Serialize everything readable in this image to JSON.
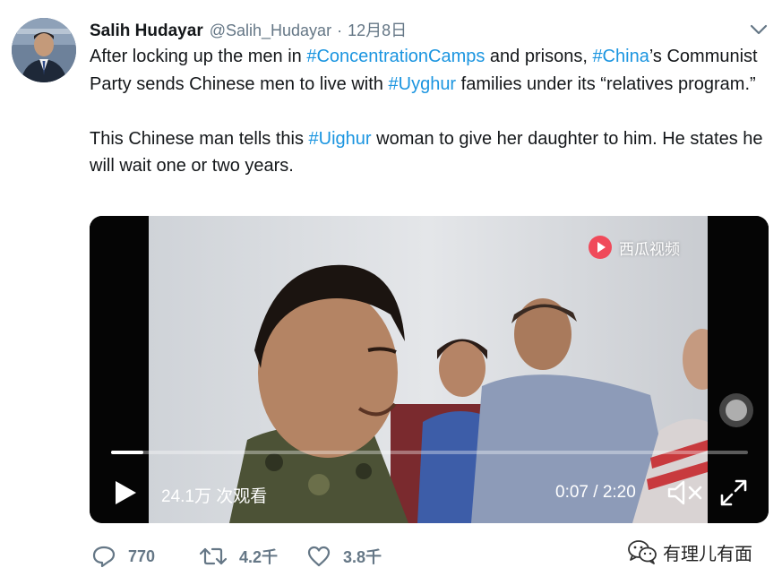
{
  "author": {
    "name": "Salih Hudayar",
    "handle": "@Salih_Hudayar",
    "separator": "·",
    "date": "12月8日"
  },
  "tweet": {
    "para1": [
      {
        "text": "After locking up the men in ",
        "tag": false
      },
      {
        "text": "#ConcentrationCamps",
        "tag": true
      },
      {
        "text": " and prisons, ",
        "tag": false
      },
      {
        "text": "#China",
        "tag": true
      },
      {
        "text": "’s Communist Party sends  Chinese men to live with ",
        "tag": false
      },
      {
        "text": "#Uyghur",
        "tag": true
      },
      {
        "text": " families under its “relatives program.”",
        "tag": false
      }
    ],
    "para2": [
      {
        "text": "This Chinese man tells this ",
        "tag": false
      },
      {
        "text": "#Uighur",
        "tag": true
      },
      {
        "text": " woman to give her daughter to him. He states he will wait one or two years.",
        "tag": false
      }
    ]
  },
  "video": {
    "watermark": "西瓜视频",
    "views": "24.1万 次观看",
    "time": "0:07 / 2:20",
    "progress_fraction": 0.05
  },
  "actions": {
    "replies": "770",
    "retweets": "4.2千",
    "likes": "3.8千"
  },
  "wechat_watermark": "有理儿有面",
  "colors": {
    "link": "#1b95e0",
    "secondary_text": "#657786"
  },
  "icons": [
    "chevron-down-icon",
    "play-icon",
    "mute-icon",
    "fullscreen-icon",
    "reply-icon",
    "retweet-icon",
    "like-icon",
    "xigua-logo-icon",
    "wechat-icon"
  ]
}
